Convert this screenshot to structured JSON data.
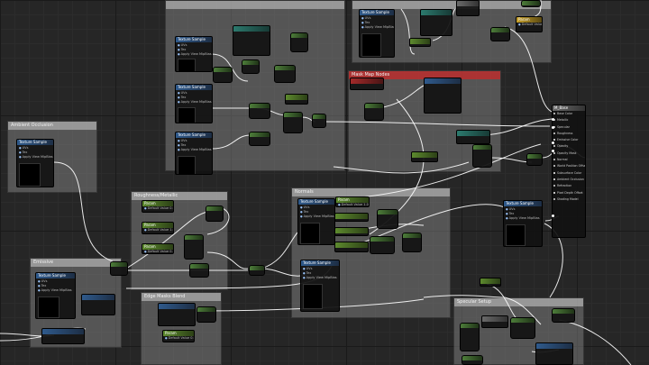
{
  "graph": {
    "comments": [
      {
        "title": ""
      },
      {
        "title": ""
      },
      {
        "title": "Ambient Occlusion"
      },
      {
        "title": "Mask Map Nodes"
      },
      {
        "title": "Roughness/Metallic"
      },
      {
        "title": "Normals"
      },
      {
        "title": "Emissive"
      },
      {
        "title": "Edge Masks Blend"
      },
      {
        "title": "Specular Setup"
      }
    ],
    "result_node": {
      "title": "M_Base",
      "pins": [
        "Base Color",
        "Metallic",
        "Specular",
        "Roughness",
        "",
        "Emissive Color",
        "Opacity",
        "Opacity Mask",
        "Normal",
        "World Position Offset",
        "",
        "Subsurface Color",
        "",
        "Ambient Occlusion",
        "Refraction",
        "",
        "Pixel Depth Offset",
        "Shading Model"
      ]
    },
    "texture_samples": [
      {
        "title": "Texture Sample",
        "pins": [
          "UVs",
          "Tex",
          "Apply View MipBias"
        ]
      },
      {
        "title": "Texture Sample",
        "pins": [
          "UVs",
          "Tex",
          "Apply View MipBias"
        ]
      },
      {
        "title": "Texture Sample",
        "pins": [
          "UVs",
          "Tex",
          "Apply View MipBias"
        ]
      },
      {
        "title": "Texture Sample",
        "pins": [
          "UVs",
          "Tex",
          "Apply View MipBias"
        ]
      },
      {
        "title": "Texture Sample",
        "pins": [
          "UVs",
          "Tex",
          "Apply View MipBias"
        ]
      },
      {
        "title": "Texture Sample",
        "pins": [
          "UVs",
          "Tex",
          "Apply View MipBias"
        ]
      },
      {
        "title": "Texture Sample",
        "pins": [
          "UVs",
          "Tex",
          "Apply View MipBias"
        ]
      },
      {
        "title": "Texture Sample",
        "pins": [
          "UVs",
          "Tex",
          "Apply View MipBias"
        ]
      },
      {
        "title": "Texture Sample",
        "pins": [
          "UVs",
          "Tex",
          "Apply View MipBias"
        ]
      }
    ],
    "param_nodes": [
      {
        "title": "Param",
        "pins": [
          "Default Value 0.0"
        ]
      },
      {
        "title": "Param",
        "pins": [
          "Default Value 1.0"
        ]
      },
      {
        "title": "Param",
        "pins": [
          "Default Value 0.5"
        ]
      },
      {
        "title": "Param",
        "pins": [
          "Default Value 2.0"
        ]
      },
      {
        "title": "Param",
        "pins": [
          "Default Value 1.0"
        ]
      },
      {
        "title": "Param",
        "pins": [
          "Default Value 0.0"
        ]
      }
    ]
  }
}
